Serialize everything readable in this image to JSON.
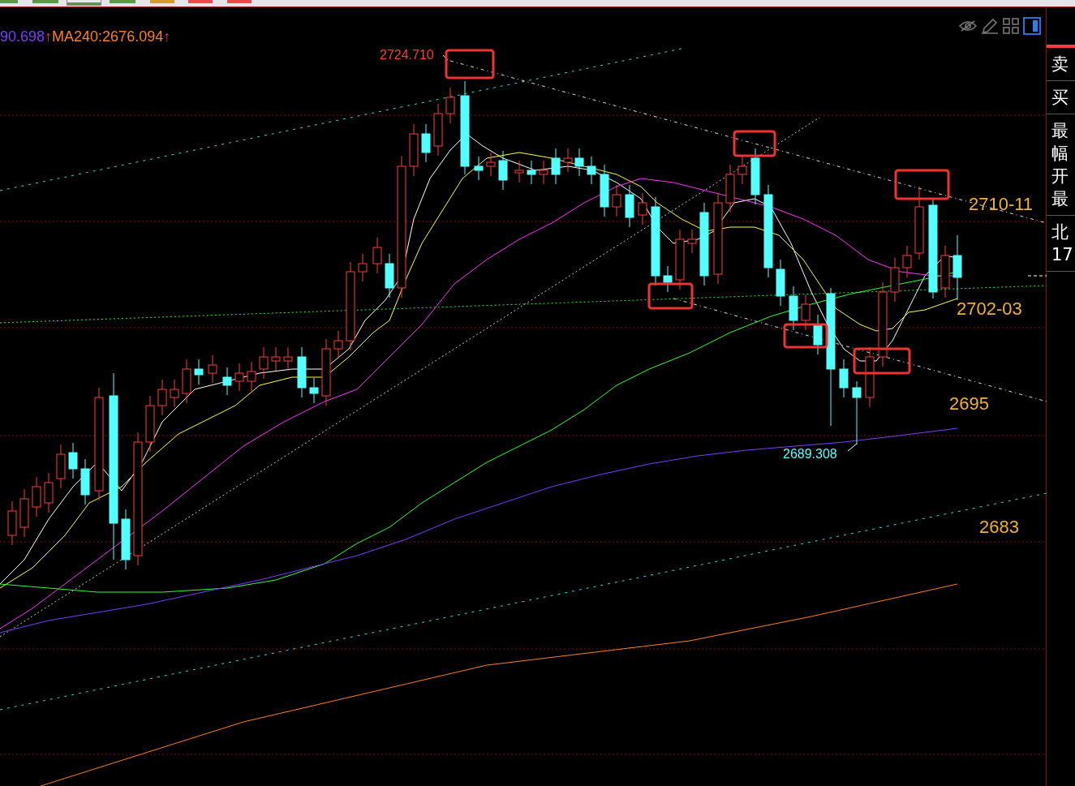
{
  "toolbar": {
    "tabs": [
      {
        "color": "#5a9a44",
        "selected": false
      },
      {
        "color": "#5a9a44",
        "selected": false
      },
      {
        "color": "#5a9a44",
        "selected": true
      },
      {
        "color": "#5a9a44",
        "selected": false
      },
      {
        "color": "#d89a2a",
        "selected": false
      },
      {
        "color": "#ee4a4a",
        "selected": false
      },
      {
        "color": "#ee4a4a",
        "selected": false
      }
    ]
  },
  "legend": [
    {
      "text": "90.698",
      "arrow": "↑",
      "color": "#7b3cff"
    },
    {
      "text": "MA240:2676.094",
      "arrow": "↑",
      "color": "#ff7f1a"
    }
  ],
  "annotations": {
    "high_label": "2724.710",
    "low_label": "2689.308"
  },
  "levels": [
    {
      "label": "2710-11"
    },
    {
      "label": "2702-03"
    },
    {
      "label": "2695"
    },
    {
      "label": "2683"
    }
  ],
  "side_panel": {
    "sections": [
      {
        "lines": [
          "卖"
        ]
      },
      {
        "lines": [
          "买"
        ]
      },
      {
        "lines": [
          "最",
          "幅",
          "开",
          "最"
        ]
      },
      {
        "lines": [
          "北",
          "17"
        ]
      }
    ]
  }
}
